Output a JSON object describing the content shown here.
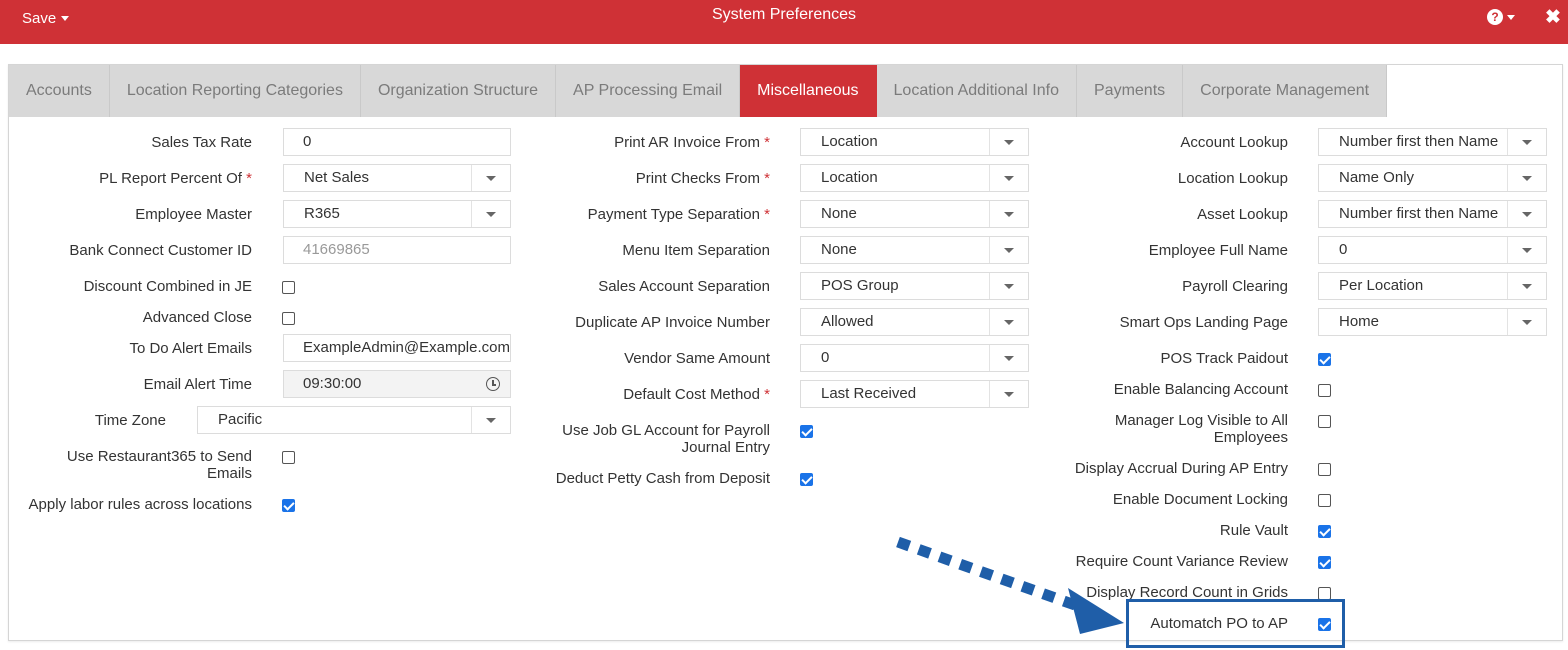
{
  "header": {
    "save_label": "Save",
    "title": "System Preferences",
    "help_icon": "question-circle-icon",
    "close_icon": "close-icon",
    "accent_color": "#cf3136"
  },
  "tabs": [
    {
      "label": "Accounts"
    },
    {
      "label": "Location Reporting Categories"
    },
    {
      "label": "Organization Structure"
    },
    {
      "label": "AP Processing Email"
    },
    {
      "label": "Miscellaneous",
      "active": true
    },
    {
      "label": "Location Additional Info"
    },
    {
      "label": "Payments"
    },
    {
      "label": "Corporate Management"
    }
  ],
  "col1": {
    "sales_tax_rate": {
      "label": "Sales Tax Rate",
      "value": "0"
    },
    "pl_report_percent_of": {
      "label": "PL Report Percent Of",
      "required": "*",
      "value": "Net Sales"
    },
    "employee_master": {
      "label": "Employee Master",
      "value": "R365"
    },
    "bank_connect_customer_id": {
      "label": "Bank Connect Customer ID",
      "value": "41669865"
    },
    "discount_combined_in_je": {
      "label": "Discount Combined in JE",
      "checked": false
    },
    "advanced_close": {
      "label": "Advanced Close",
      "checked": false
    },
    "to_do_alert_emails": {
      "label": "To Do Alert Emails",
      "value": "ExampleAdmin@Example.com"
    },
    "email_alert_time": {
      "label": "Email Alert Time",
      "value": "09:30:00",
      "icon": "clock-icon"
    },
    "time_zone": {
      "label": "Time Zone",
      "value": "Pacific"
    },
    "use_restaurant365_to_send_emails": {
      "label1": "Use Restaurant365 to Send",
      "label2": "Emails",
      "checked": false
    },
    "apply_labor_rules": {
      "label": "Apply labor rules across locations",
      "checked": true
    }
  },
  "col2": {
    "print_ar_invoice_from": {
      "label": "Print AR Invoice From",
      "required": "*",
      "value": "Location"
    },
    "print_checks_from": {
      "label": "Print Checks From",
      "required": "*",
      "value": "Location"
    },
    "payment_type_separation": {
      "label": "Payment Type Separation",
      "required": "*",
      "value": "None"
    },
    "menu_item_separation": {
      "label": "Menu Item Separation",
      "value": "None"
    },
    "sales_account_separation": {
      "label": "Sales Account Separation",
      "value": "POS Group"
    },
    "duplicate_ap_invoice_number": {
      "label": "Duplicate AP Invoice Number",
      "value": "Allowed"
    },
    "vendor_same_amount": {
      "label": "Vendor Same Amount",
      "value": "0"
    },
    "default_cost_method": {
      "label": "Default Cost Method",
      "required": "*",
      "value": "Last Received"
    },
    "use_job_gl_account": {
      "label1": "Use Job GL Account for Payroll",
      "label2": "Journal Entry",
      "checked": true
    },
    "deduct_petty_cash": {
      "label": "Deduct Petty Cash from Deposit",
      "checked": true
    }
  },
  "col3": {
    "account_lookup": {
      "label": "Account Lookup",
      "value": "Number first then Name"
    },
    "location_lookup": {
      "label": "Location Lookup",
      "value": "Name Only"
    },
    "asset_lookup": {
      "label": "Asset Lookup",
      "value": "Number first then Name"
    },
    "employee_full_name": {
      "label": "Employee Full Name",
      "value": "0"
    },
    "payroll_clearing": {
      "label": "Payroll Clearing",
      "value": "Per Location"
    },
    "smart_ops_landing_page": {
      "label": "Smart Ops Landing Page",
      "value": "Home"
    },
    "pos_track_paidout": {
      "label": "POS Track Paidout",
      "checked": true
    },
    "enable_balancing_account": {
      "label": "Enable Balancing Account",
      "checked": false
    },
    "manager_log_visible": {
      "label1": "Manager Log Visible to All",
      "label2": "Employees",
      "checked": false
    },
    "display_accrual": {
      "label": "Display Accrual During AP Entry",
      "checked": false
    },
    "enable_document_locking": {
      "label": "Enable Document Locking",
      "checked": false
    },
    "rule_vault": {
      "label": "Rule Vault",
      "checked": true
    },
    "require_count_variance_review": {
      "label": "Require Count Variance Review",
      "checked": true
    },
    "display_record_count": {
      "label": "Display Record Count in Grids",
      "checked": false
    },
    "automatch_po_to_ap": {
      "label": "Automatch PO to AP",
      "checked": true
    }
  },
  "annotation": {
    "arrow_icon": "dotted-arrow-icon",
    "color": "#1f5ea8"
  }
}
